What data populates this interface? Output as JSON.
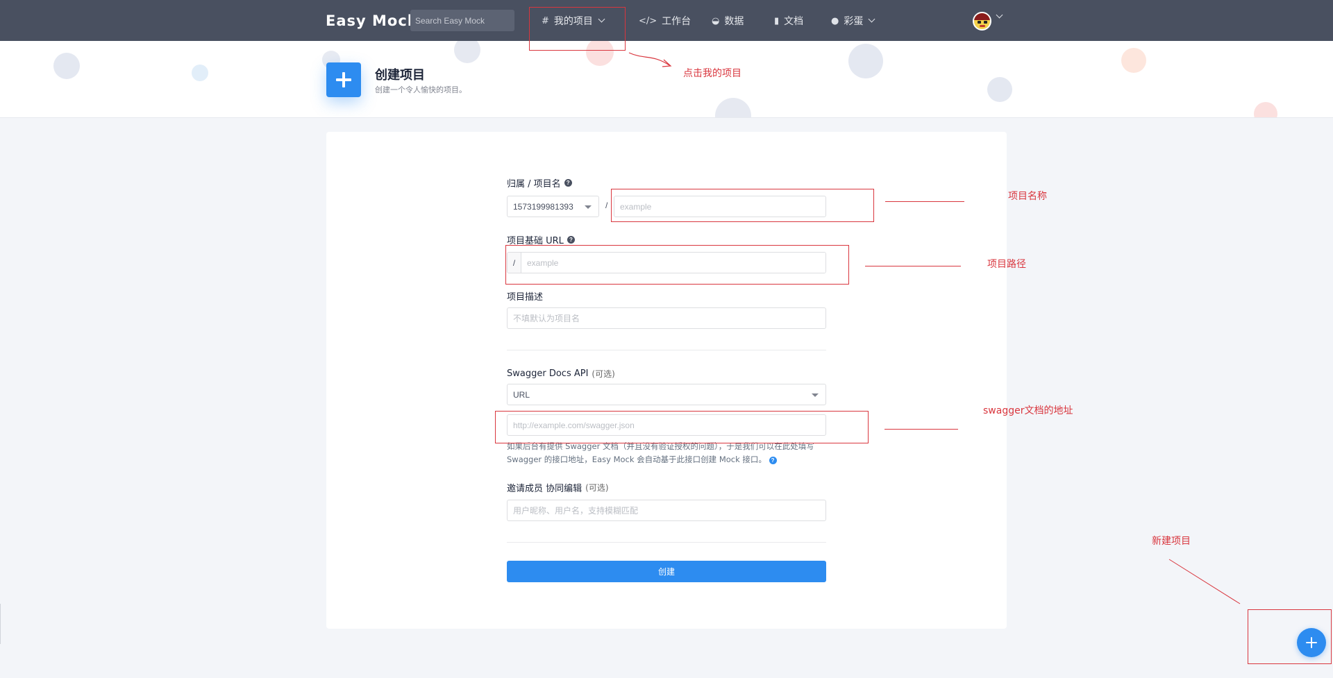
{
  "nav": {
    "logo": "Easy Mock",
    "search_placeholder": "Search Easy Mock",
    "items": [
      {
        "icon": "hash-icon",
        "label": "我的项目",
        "dropdown": true
      },
      {
        "icon": "code-icon",
        "label": "工作台",
        "dropdown": false
      },
      {
        "icon": "dashboard-icon",
        "label": "数据",
        "dropdown": false
      },
      {
        "icon": "book-icon",
        "label": "文档",
        "dropdown": false
      },
      {
        "icon": "egg-icon",
        "label": "彩蛋",
        "dropdown": true
      }
    ]
  },
  "hero": {
    "title": "创建项目",
    "subtitle": "创建一个令人愉快的项目。"
  },
  "form": {
    "owner_name_label": "归属 / 项目名",
    "owner_value": "1573199981393",
    "name_placeholder": "example",
    "base_url_label": "项目基础 URL",
    "base_url_prefix": "/",
    "base_url_placeholder": "example",
    "desc_label": "项目描述",
    "desc_placeholder": "不填默认为项目名",
    "swagger_label": "Swagger Docs API",
    "swagger_optional": "(可选)",
    "swagger_type_value": "URL",
    "swagger_url_placeholder": "http://example.com/swagger.json",
    "swagger_note": "如果后台有提供 Swagger 文档（并且没有验证授权的问题），于是我们可以在此处填写 Swagger 的接口地址，Easy Mock 会自动基于此接口创建 Mock 接口。",
    "members_label": "邀请成员 协同编辑",
    "members_optional": "(可选)",
    "members_placeholder": "用户昵称、用户名，支持模糊匹配",
    "create_button": "创建"
  },
  "annotations": {
    "click_my_projects": "点击我的项目",
    "project_name": "项目名称",
    "project_path": "项目路径",
    "swagger_address": "swagger文档的地址",
    "new_project": "新建项目"
  },
  "colors": {
    "nav_bg": "#495060",
    "primary": "#2d8cf0",
    "annotation": "#d9363e"
  }
}
